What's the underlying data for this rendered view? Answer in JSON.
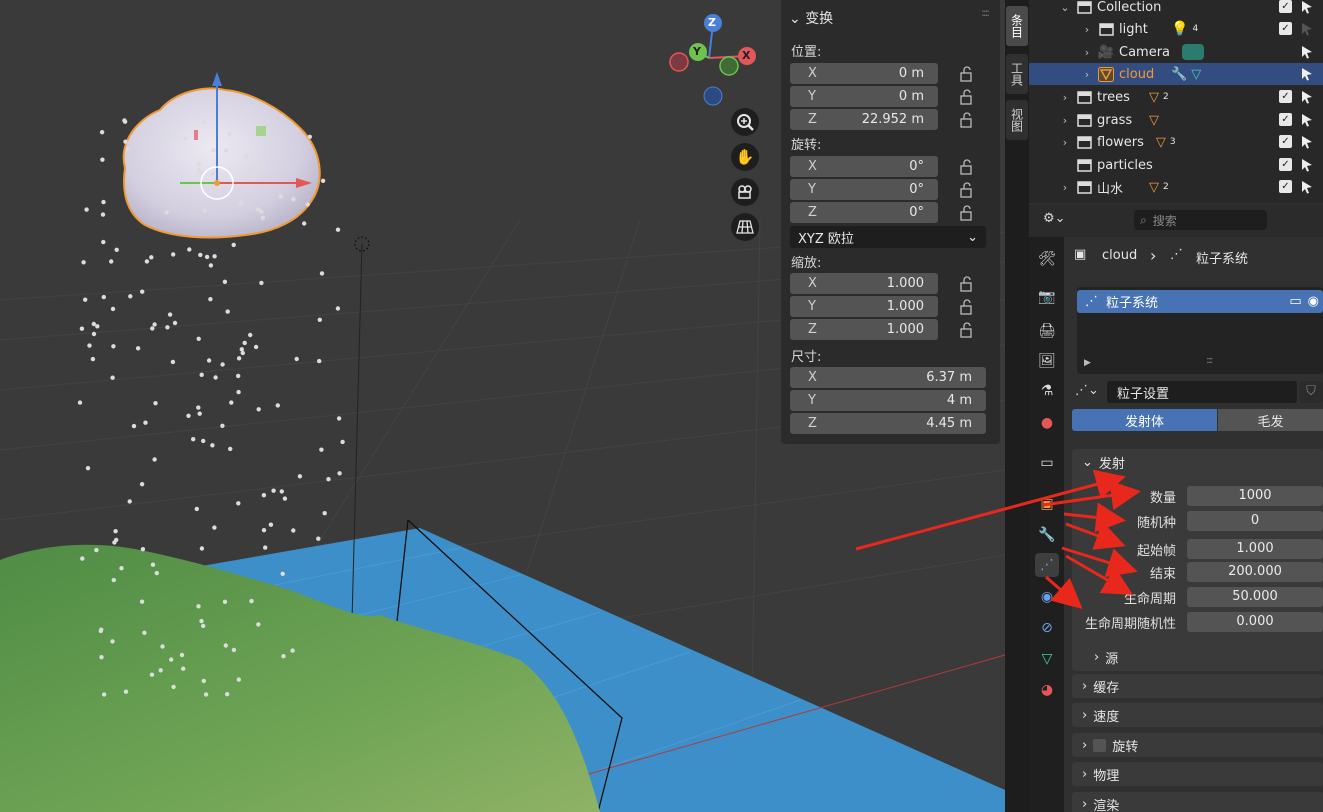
{
  "viewport": {
    "gizmo": {
      "x": "X",
      "y": "Y",
      "z": "Z"
    },
    "nav_buttons": [
      "zoom-icon",
      "hand-icon",
      "camera-icon",
      "grid-icon"
    ]
  },
  "transform_panel": {
    "title": "变换",
    "location_label": "位置:",
    "location": [
      {
        "axis": "X",
        "value": "0 m"
      },
      {
        "axis": "Y",
        "value": "0 m"
      },
      {
        "axis": "Z",
        "value": "22.952 m"
      }
    ],
    "rotation_label": "旋转:",
    "rotation": [
      {
        "axis": "X",
        "value": "0°"
      },
      {
        "axis": "Y",
        "value": "0°"
      },
      {
        "axis": "Z",
        "value": "0°"
      }
    ],
    "rotation_mode": "XYZ 欧拉",
    "scale_label": "缩放:",
    "scale": [
      {
        "axis": "X",
        "value": "1.000"
      },
      {
        "axis": "Y",
        "value": "1.000"
      },
      {
        "axis": "Z",
        "value": "1.000"
      }
    ],
    "dimensions_label": "尺寸:",
    "dimensions": [
      {
        "axis": "X",
        "value": "6.37 m"
      },
      {
        "axis": "Y",
        "value": "4 m"
      },
      {
        "axis": "Z",
        "value": "4.45 m"
      }
    ]
  },
  "side_tabs": [
    "条目",
    "工具",
    "视图"
  ],
  "outliner": {
    "rows": [
      {
        "name": "Collection",
        "badge": ""
      },
      {
        "name": "light",
        "badge": "4"
      },
      {
        "name": "Camera",
        "badge": ""
      },
      {
        "name": "cloud",
        "badge": ""
      },
      {
        "name": "trees",
        "badge": "2"
      },
      {
        "name": "grass",
        "badge": ""
      },
      {
        "name": "flowers",
        "badge": "3"
      },
      {
        "name": "particles",
        "badge": ""
      },
      {
        "name": "山水",
        "badge": "2"
      }
    ]
  },
  "properties": {
    "search_placeholder": "搜索",
    "breadcrumb_object": "cloud",
    "breadcrumb_sep": "›",
    "breadcrumb_section": "粒子系统",
    "list_item": "粒子系统",
    "list_dots": "::::",
    "settings_name": "粒子设置",
    "type_emitter": "发射体",
    "type_hair": "毛发",
    "emission": {
      "header": "发射",
      "fields": [
        {
          "label": "数量",
          "value": "1000"
        },
        {
          "label": "随机种",
          "value": "0"
        },
        {
          "label": "起始帧",
          "value": "1.000"
        },
        {
          "label": "结束",
          "value": "200.000"
        },
        {
          "label": "生命周期",
          "value": "50.000"
        },
        {
          "label": "生命周期随机性",
          "value": "0.000"
        }
      ],
      "source": "源"
    },
    "panels": [
      "缓存",
      "速度",
      "旋转",
      "物理",
      "渲染"
    ]
  },
  "colors": {
    "selection": "#334d80",
    "active_blue": "#4772b3",
    "annotation_arrow": "#e8281c",
    "ground_plane": "#3d8fc9",
    "terrain": "#5f9a4a",
    "cloud": "#d8d8e6",
    "object_outline": "#f09a36"
  }
}
